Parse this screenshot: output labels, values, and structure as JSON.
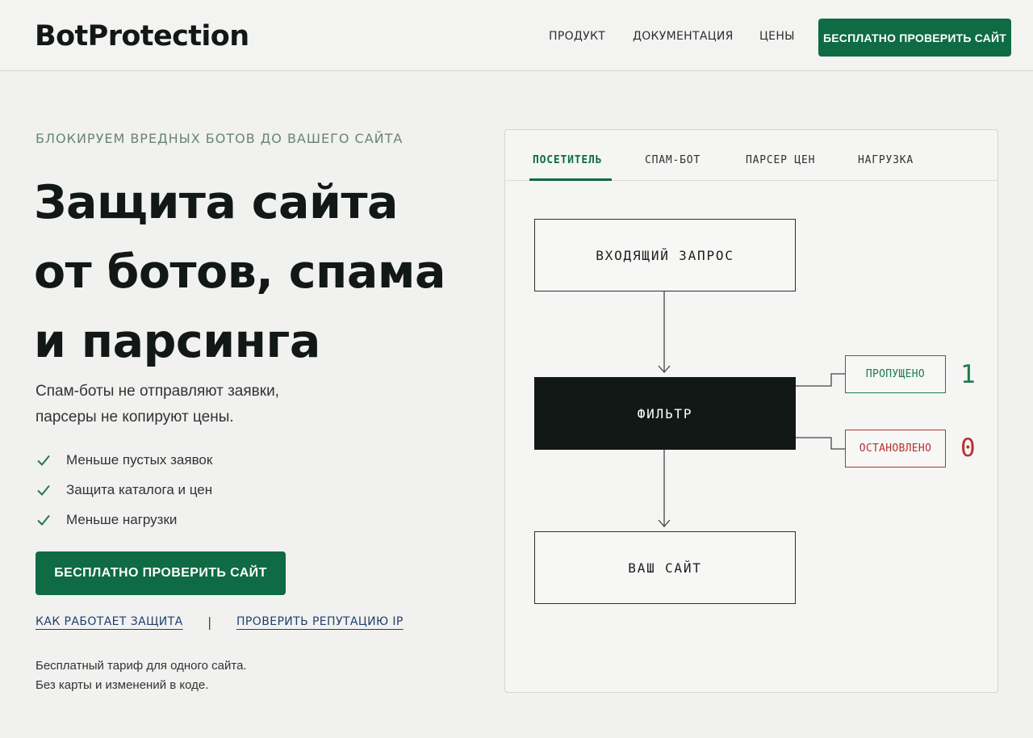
{
  "header": {
    "logo": "BotProtection",
    "nav": [
      "ПРОДУКТ",
      "ДОКУМЕНТАЦИЯ",
      "ЦЕНЫ"
    ],
    "cta_label": "БЕСПЛАТНО ПРОВЕРИТЬ САЙТ"
  },
  "hero": {
    "eyebrow": "БЛОКИРУЕМ ВРЕДНЫХ БОТОВ ДО ВАШЕГО САЙТА",
    "title_lines": [
      "Защита сайта",
      "от ботов, спама",
      "и парсинга"
    ],
    "subtitle_lines": [
      "Спам-боты не отправляют заявки,",
      "парсеры не копируют цены."
    ],
    "features": [
      "Меньше пустых заявок",
      "Защита каталога и цен",
      "Меньше нагрузки"
    ],
    "cta_label": "БЕСПЛАТНО ПРОВЕРИТЬ САЙТ",
    "links": [
      "КАК РАБОТАЕТ ЗАЩИТА",
      "ПРОВЕРИТЬ РЕПУТАЦИЮ IP"
    ],
    "link_separator": "|",
    "note_lines": [
      "Бесплатный тариф для одного сайта.",
      "Без карты и изменений в коде."
    ],
    "accent_color": "#0e6b43"
  },
  "panel": {
    "tabs": [
      "ПОСЕТИТЕЛЬ",
      "СПАМ-БОТ",
      "ПАРСЕР ЦЕН",
      "НАГРУЗКА"
    ],
    "active_tab": "ПОСЕТИТЕЛЬ",
    "flow": {
      "request": "ВХОДЯЩИЙ ЗАПРОС",
      "filter": "ФИЛЬТР",
      "site": "ВАШ САЙТ"
    },
    "passed": {
      "label": "ПРОПУЩЕНО",
      "count": "1",
      "color": "#1f7a4c"
    },
    "stopped": {
      "label": "ОСТАНОВЛЕНО",
      "count": "0",
      "color": "#b8322e"
    }
  }
}
